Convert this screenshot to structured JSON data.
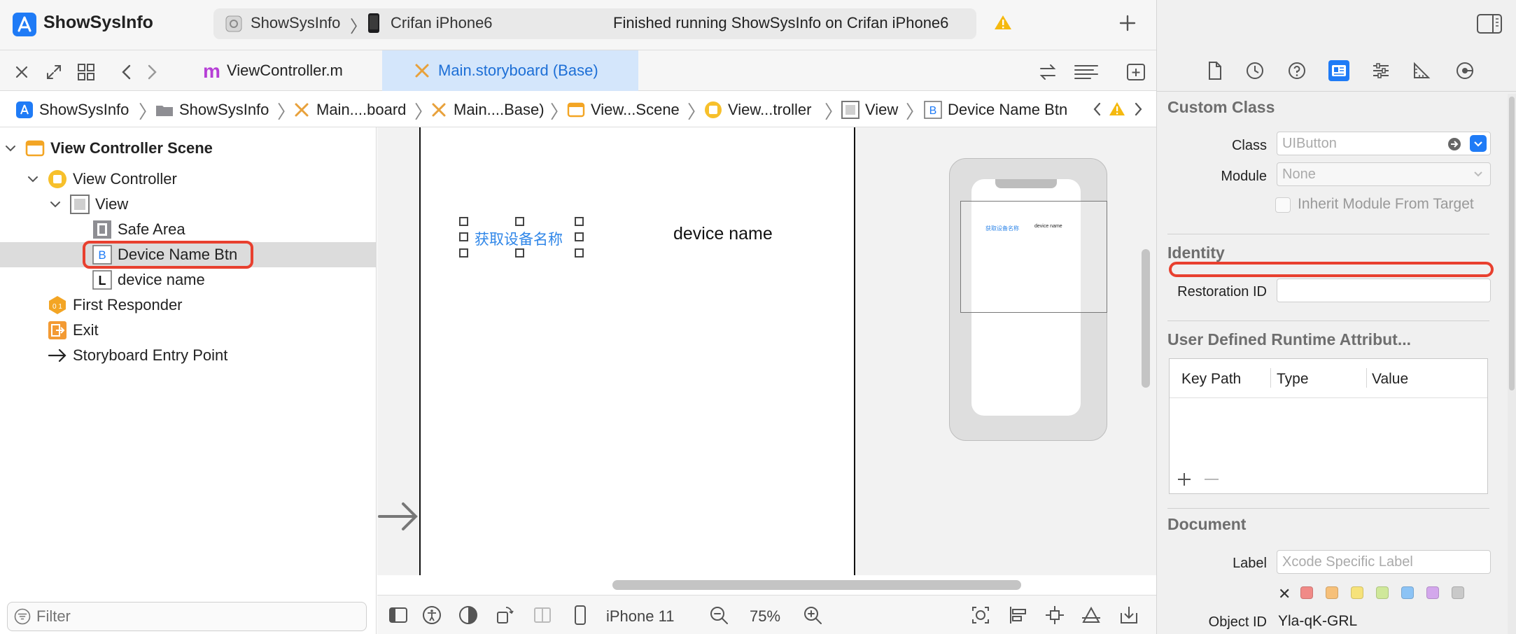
{
  "app": {
    "title": "ShowSysInfo"
  },
  "toolbar": {
    "scheme": "ShowSysInfo",
    "destination": "Crifan iPhone6",
    "status": "Finished running ShowSysInfo on Crifan iPhone6"
  },
  "tabs": [
    {
      "label": "ViewController.m",
      "icon": "m"
    },
    {
      "label": "Main.storyboard (Base)"
    }
  ],
  "breadcrumb": [
    "ShowSysInfo",
    "ShowSysInfo",
    "Main....board",
    "Main....Base)",
    "View...Scene",
    "View...troller",
    "View",
    "Device Name Btn"
  ],
  "outline": {
    "scene": "View Controller Scene",
    "view_controller": "View Controller",
    "view": "View",
    "safe_area": "Safe Area",
    "button": "Device Name Btn",
    "button_badge": "B",
    "label": "device name",
    "label_badge": "L",
    "first_responder": "First Responder",
    "exit": "Exit",
    "entry_point": "Storyboard Entry Point"
  },
  "filter": {
    "placeholder": "Filter"
  },
  "canvas": {
    "button_title": "获取设备名称",
    "label_text": "device name",
    "mini_button_title": "获取设备名称",
    "mini_label_text": "device name"
  },
  "canvas_bar": {
    "device": "iPhone 11",
    "zoom": "75%"
  },
  "inspector": {
    "custom_class": {
      "title": "Custom Class",
      "class_label": "Class",
      "class_placeholder": "UIButton",
      "module_label": "Module",
      "module_placeholder": "None",
      "inherit_label": "Inherit Module From Target"
    },
    "identity": {
      "title": "Identity",
      "restoration_label": "Restoration ID",
      "restoration_value": ""
    },
    "runtime_attrs": {
      "title": "User Defined Runtime Attribut...",
      "columns": [
        "Key Path",
        "Type",
        "Value"
      ]
    },
    "document": {
      "title": "Document",
      "label_label": "Label",
      "label_placeholder": "Xcode Specific Label",
      "object_id_label": "Object ID",
      "object_id": "Yla-qK-GRL",
      "swatches": [
        "#f08a87",
        "#f6c07a",
        "#f6e27a",
        "#cfe89a",
        "#8cc3f5",
        "#d3a7ec",
        "#c9c9c9"
      ]
    }
  },
  "colors": {
    "accent": "#1f7bf6",
    "highlight": "#e8402f",
    "button_text": "#2f86e8"
  }
}
